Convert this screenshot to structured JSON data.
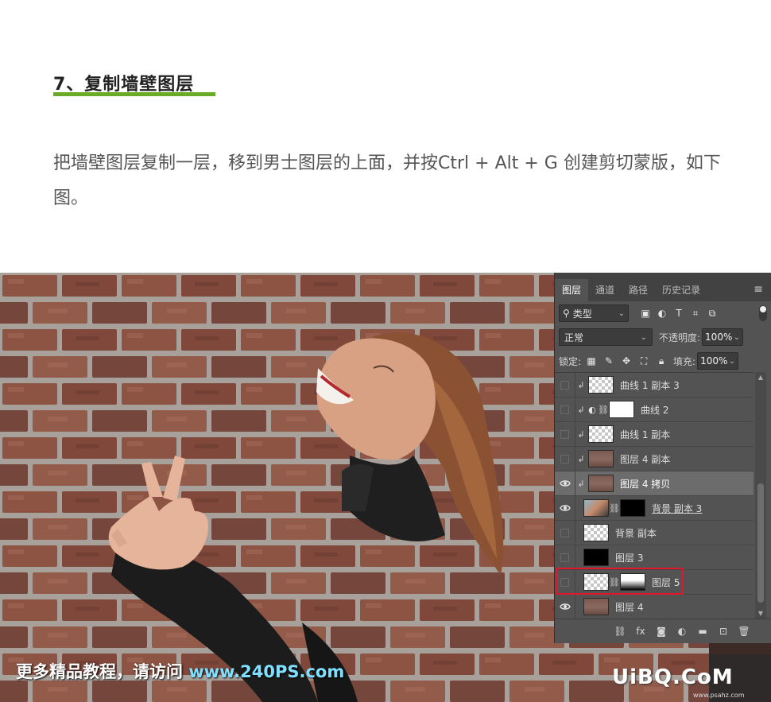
{
  "article": {
    "step_title": "7、复制墙壁图层",
    "body": "把墙壁图层复制一层，移到男士图层的上面，并按Ctrl + Alt + G 创建剪切蒙版，如下图。"
  },
  "colors": {
    "accent_green": "#6aab26",
    "highlight_red": "#e3172b",
    "panel_bg": "#535353"
  },
  "watermark": {
    "cn_text": "更多精品教程，请访问",
    "url": "www.240PS.com",
    "logo": "UiBQ.CoM",
    "logo_sub": "www.psahz.com"
  },
  "layers_panel": {
    "tabs": [
      {
        "label": "图层",
        "active": true
      },
      {
        "label": "通道",
        "active": false
      },
      {
        "label": "路径",
        "active": false
      },
      {
        "label": "历史记录",
        "active": false
      }
    ],
    "filter_label": "类型",
    "blend_mode": "正常",
    "opacity_label": "不透明度:",
    "opacity_value": "100%",
    "lock_label": "锁定:",
    "fill_label": "填充:",
    "fill_value": "100%",
    "layers": [
      {
        "name": "曲线 1 副本 3",
        "visible": false,
        "clipped": true,
        "thumb": "trans",
        "selected": false
      },
      {
        "name": "曲线 2",
        "visible": false,
        "clipped": true,
        "thumb": "white",
        "selected": false,
        "adjustment": true,
        "mask": true
      },
      {
        "name": "曲线 1 副本",
        "visible": false,
        "clipped": true,
        "thumb": "trans",
        "selected": false
      },
      {
        "name": "图层 4 副本",
        "visible": false,
        "clipped": true,
        "thumb": "brick",
        "selected": false
      },
      {
        "name": "图层 4 拷贝",
        "visible": true,
        "clipped": true,
        "thumb": "brick",
        "selected": true
      },
      {
        "name": "背景 副本 3",
        "visible": true,
        "clipped": false,
        "thumb": "photo",
        "selected": false,
        "mask": true,
        "underlined": true
      },
      {
        "name": "背景 副本",
        "visible": false,
        "clipped": false,
        "thumb": "trans",
        "selected": false
      },
      {
        "name": "图层 3",
        "visible": false,
        "clipped": false,
        "thumb": "black",
        "selected": false
      },
      {
        "name": "图层 5",
        "visible": false,
        "clipped": false,
        "thumb": "sil",
        "selected": false,
        "mask": true
      },
      {
        "name": "图层 4",
        "visible": true,
        "clipped": false,
        "thumb": "brick",
        "selected": false
      }
    ]
  }
}
